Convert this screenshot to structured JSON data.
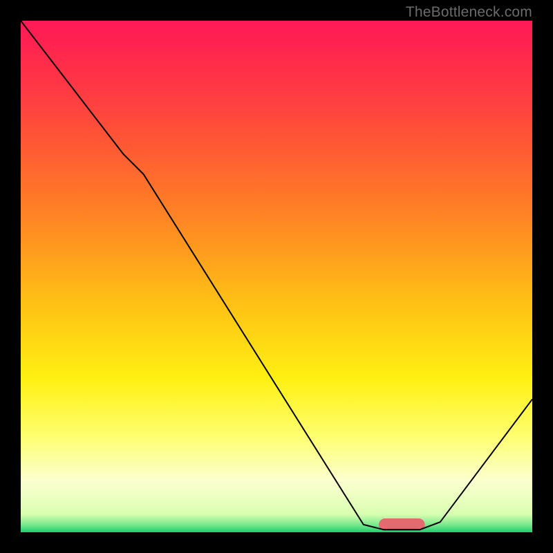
{
  "watermark": "TheBottleneck.com",
  "chart_data": {
    "type": "line",
    "title": "",
    "xlabel": "",
    "ylabel": "",
    "xlim": [
      0,
      100
    ],
    "ylim": [
      0,
      100
    ],
    "background": {
      "type": "vertical-gradient",
      "stops": [
        {
          "offset": 0.0,
          "color": "#ff1956"
        },
        {
          "offset": 0.12,
          "color": "#ff3545"
        },
        {
          "offset": 0.25,
          "color": "#ff5a33"
        },
        {
          "offset": 0.4,
          "color": "#ff8a22"
        },
        {
          "offset": 0.55,
          "color": "#ffc015"
        },
        {
          "offset": 0.7,
          "color": "#fff012"
        },
        {
          "offset": 0.82,
          "color": "#feff77"
        },
        {
          "offset": 0.9,
          "color": "#fbffd0"
        },
        {
          "offset": 0.965,
          "color": "#d8ffb0"
        },
        {
          "offset": 0.985,
          "color": "#7de88d"
        },
        {
          "offset": 1.0,
          "color": "#1fce6f"
        }
      ]
    },
    "series": [
      {
        "name": "bottleneck-curve",
        "color": "#000000",
        "stroke_width": 2,
        "points": [
          {
            "x": 0.0,
            "y": 100.0
          },
          {
            "x": 20.0,
            "y": 74.0
          },
          {
            "x": 24.0,
            "y": 70.0
          },
          {
            "x": 67.0,
            "y": 1.5
          },
          {
            "x": 71.0,
            "y": 0.5
          },
          {
            "x": 78.0,
            "y": 0.5
          },
          {
            "x": 82.0,
            "y": 2.0
          },
          {
            "x": 100.0,
            "y": 26.0
          }
        ]
      }
    ],
    "markers": [
      {
        "name": "optimal-zone",
        "shape": "rounded-rect",
        "color": "#e46a72",
        "x_start": 70.0,
        "x_end": 79.0,
        "y": 1.5,
        "thickness": 2.4
      }
    ]
  }
}
